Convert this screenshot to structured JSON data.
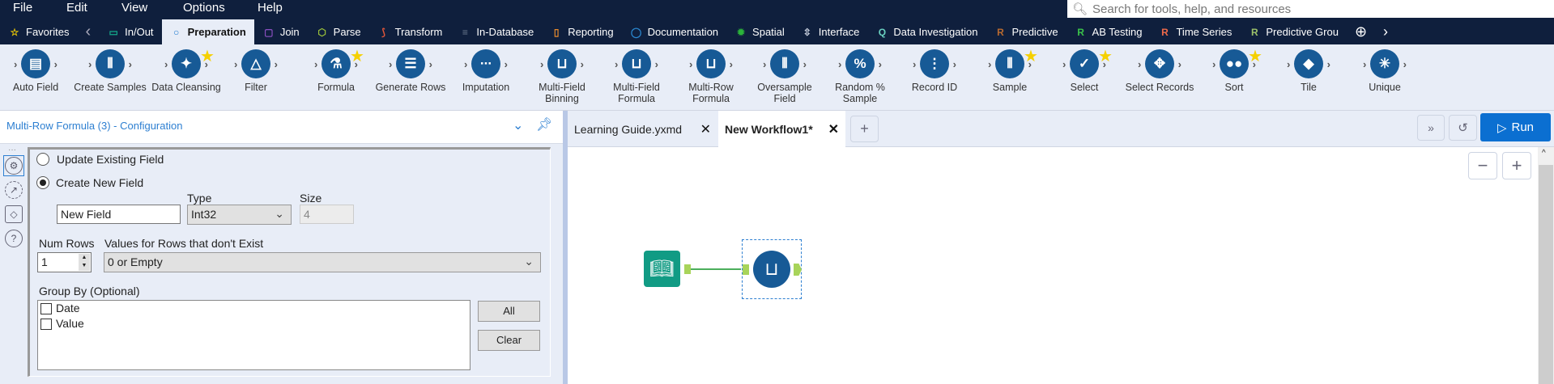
{
  "menu": [
    "File",
    "Edit",
    "View",
    "Options",
    "Help"
  ],
  "search": {
    "placeholder": "Search for tools, help, and resources"
  },
  "categories": [
    {
      "label": "Favorites",
      "icon": "star-icon",
      "color": "#f5d000"
    },
    {
      "label": "In/Out",
      "icon": "folder-icon",
      "color": "#14a88a"
    },
    {
      "label": "Preparation",
      "icon": "circle-icon",
      "color": "#1f7ad0"
    },
    {
      "label": "Join",
      "icon": "square-icon",
      "color": "#8a4fc0"
    },
    {
      "label": "Parse",
      "icon": "hexagon-icon",
      "color": "#9cc23a"
    },
    {
      "label": "Transform",
      "icon": "transform-icon",
      "color": "#e0563a"
    },
    {
      "label": "In-Database",
      "icon": "database-icon",
      "color": "#6b7a90"
    },
    {
      "label": "Reporting",
      "icon": "document-icon",
      "color": "#e88a2c"
    },
    {
      "label": "Documentation",
      "icon": "comment-icon",
      "color": "#2a88d0"
    },
    {
      "label": "Spatial",
      "icon": "spatial-icon",
      "color": "#2bb33a"
    },
    {
      "label": "Interface",
      "icon": "interface-icon",
      "color": "#cfd6e4"
    },
    {
      "label": "Data Investigation",
      "icon": "magnifier-icon",
      "color": "#6ad0c0"
    },
    {
      "label": "Predictive",
      "icon": "r-icon",
      "color": "#b86a30"
    },
    {
      "label": "AB Testing",
      "icon": "r-icon",
      "color": "#3ac24a"
    },
    {
      "label": "Time Series",
      "icon": "r-icon",
      "color": "#f06a4a"
    },
    {
      "label": "Predictive Grou",
      "icon": "r-icon",
      "color": "#9cc26a"
    }
  ],
  "tools": [
    {
      "label": "Auto Field",
      "glyph": "▤",
      "star": false
    },
    {
      "label": "Create Samples",
      "glyph": "⫴",
      "star": false
    },
    {
      "label": "Data Cleansing",
      "glyph": "✦",
      "star": true
    },
    {
      "label": "Filter",
      "glyph": "△",
      "star": false
    },
    {
      "label": "Formula",
      "glyph": "⚗",
      "star": true
    },
    {
      "label": "Generate Rows",
      "glyph": "☰",
      "star": false
    },
    {
      "label": "Imputation",
      "glyph": "∙∙∙",
      "star": false
    },
    {
      "label": "Multi-Field Binning",
      "glyph": "⊔",
      "star": false
    },
    {
      "label": "Multi-Field Formula",
      "glyph": "⊔",
      "star": false
    },
    {
      "label": "Multi-Row Formula",
      "glyph": "⊔",
      "star": false
    },
    {
      "label": "Oversample Field",
      "glyph": "⫴",
      "star": false
    },
    {
      "label": "Random % Sample",
      "glyph": "%",
      "star": false
    },
    {
      "label": "Record ID",
      "glyph": "⋮",
      "star": false
    },
    {
      "label": "Sample",
      "glyph": "⫴",
      "star": true
    },
    {
      "label": "Select",
      "glyph": "✓",
      "star": true
    },
    {
      "label": "Select Records",
      "glyph": "✥",
      "star": false
    },
    {
      "label": "Sort",
      "glyph": "●●",
      "star": true
    },
    {
      "label": "Tile",
      "glyph": "◆",
      "star": false
    },
    {
      "label": "Unique",
      "glyph": "✳",
      "star": false
    }
  ],
  "config": {
    "title": "Multi-Row Formula (3) - Configuration",
    "update_existing": "Update Existing Field",
    "create_new": "Create New  Field",
    "type_label": "Type",
    "size_label": "Size",
    "new_field_value": "New Field",
    "type_value": "Int32",
    "size_value": "4",
    "num_rows_label": "Num Rows",
    "num_rows_value": "1",
    "values_label": "Values for Rows that don't Exist",
    "values_value": "0 or Empty",
    "group_by_label": "Group By (Optional)",
    "group_fields": [
      "Date",
      "Value"
    ],
    "all_label": "All",
    "clear_label": "Clear"
  },
  "doc_tabs": [
    {
      "label": "Learning Guide.yxmd",
      "active": false
    },
    {
      "label": "New Workflow1*",
      "active": true
    }
  ],
  "run_label": "Run",
  "colors": {
    "navy": "#0f1f3d",
    "accent": "#0b6fd1",
    "tool_blue": "#175a96"
  }
}
